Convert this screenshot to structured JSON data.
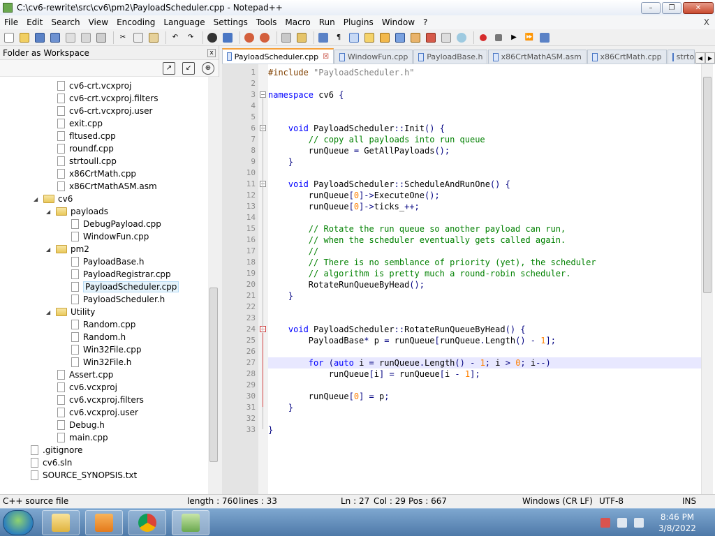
{
  "window": {
    "title": "C:\\cv6-rewrite\\src\\cv6\\pm2\\PayloadScheduler.cpp - Notepad++"
  },
  "menu": {
    "items": [
      "File",
      "Edit",
      "Search",
      "View",
      "Encoding",
      "Language",
      "Settings",
      "Tools",
      "Macro",
      "Run",
      "Plugins",
      "Window",
      "?"
    ],
    "close": "X"
  },
  "panel": {
    "title": "Folder as Workspace",
    "close": "x"
  },
  "tree": [
    {
      "label": "cv6-crt.vcxproj",
      "type": "file"
    },
    {
      "label": "cv6-crt.vcxproj.filters",
      "type": "file"
    },
    {
      "label": "cv6-crt.vcxproj.user",
      "type": "file"
    },
    {
      "label": "exit.cpp",
      "type": "file"
    },
    {
      "label": "fltused.cpp",
      "type": "file"
    },
    {
      "label": "roundf.cpp",
      "type": "file"
    },
    {
      "label": "strtoull.cpp",
      "type": "file"
    },
    {
      "label": "x86CrtMath.cpp",
      "type": "file"
    },
    {
      "label": "x86CrtMathASM.asm",
      "type": "file"
    },
    {
      "label": "cv6",
      "type": "folder"
    },
    {
      "label": "payloads",
      "type": "folder"
    },
    {
      "label": "DebugPayload.cpp",
      "type": "file"
    },
    {
      "label": "WindowFun.cpp",
      "type": "file"
    },
    {
      "label": "pm2",
      "type": "folder"
    },
    {
      "label": "PayloadBase.h",
      "type": "file"
    },
    {
      "label": "PayloadRegistrar.cpp",
      "type": "file"
    },
    {
      "label": "PayloadScheduler.cpp",
      "type": "file",
      "selected": true
    },
    {
      "label": "PayloadScheduler.h",
      "type": "file"
    },
    {
      "label": "Utility",
      "type": "folder"
    },
    {
      "label": "Random.cpp",
      "type": "file"
    },
    {
      "label": "Random.h",
      "type": "file"
    },
    {
      "label": "Win32File.cpp",
      "type": "file"
    },
    {
      "label": "Win32File.h",
      "type": "file"
    },
    {
      "label": "Assert.cpp",
      "type": "file"
    },
    {
      "label": "cv6.vcxproj",
      "type": "file"
    },
    {
      "label": "cv6.vcxproj.filters",
      "type": "file"
    },
    {
      "label": "cv6.vcxproj.user",
      "type": "file"
    },
    {
      "label": "Debug.h",
      "type": "file"
    },
    {
      "label": "main.cpp",
      "type": "file"
    },
    {
      "label": ".gitignore",
      "type": "file"
    },
    {
      "label": "cv6.sln",
      "type": "file"
    },
    {
      "label": "SOURCE_SYNOPSIS.txt",
      "type": "file"
    }
  ],
  "tabs": [
    {
      "label": "PayloadScheduler.cpp",
      "active": true
    },
    {
      "label": "WindowFun.cpp"
    },
    {
      "label": "PayloadBase.h"
    },
    {
      "label": "x86CrtMathASM.asm"
    },
    {
      "label": "x86CrtMath.cpp"
    },
    {
      "label": "strto"
    }
  ],
  "code": {
    "current_line": 27,
    "lines": [
      "#include \"PayloadScheduler.h\"",
      "",
      "namespace cv6 {",
      "",
      "",
      "    void PayloadScheduler::Init() {",
      "        // copy all payloads into run queue",
      "        runQueue = GetAllPayloads();",
      "    }",
      "",
      "    void PayloadScheduler::ScheduleAndRunOne() {",
      "        runQueue[0]->ExecuteOne();",
      "        runQueue[0]->ticks_++;",
      "",
      "        // Rotate the run queue so another payload can run,",
      "        // when the scheduler eventually gets called again.",
      "        //",
      "        // There is no semblance of priority (yet), the scheduler",
      "        // algorithm is pretty much a round-robin scheduler.",
      "        RotateRunQueueByHead();",
      "    }",
      "",
      "",
      "    void PayloadScheduler::RotateRunQueueByHead() {",
      "        PayloadBase* p = runQueue[runQueue.Length() - 1];",
      "",
      "        for (auto i = runQueue.Length() - 1; i > 0; i--)",
      "            runQueue[i] = runQueue[i - 1];",
      "",
      "        runQueue[0] = p;",
      "    }",
      "",
      "}"
    ]
  },
  "status": {
    "filetype": "C++ source file",
    "length": "length : 760",
    "lines": "lines : 33",
    "ln": "Ln : 27",
    "col": "Col : 29",
    "pos": "Pos : 667",
    "eol": "Windows (CR LF)",
    "encoding": "UTF-8",
    "mode": "INS"
  },
  "clock": {
    "time": "8:46 PM",
    "date": "3/8/2022"
  }
}
